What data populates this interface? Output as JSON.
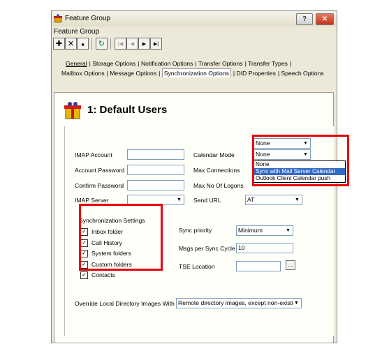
{
  "window": {
    "title": "Feature Group",
    "menu_label": "Feature Group",
    "help_btn": "?",
    "close_btn": "✕"
  },
  "toolbar": {
    "add": "✚",
    "delete": "✕",
    "save": "▪",
    "refresh": "↻",
    "first": "|◀",
    "prev": "◀",
    "next": "▶",
    "last": "▶|"
  },
  "tabs_row1": [
    "General",
    "Storage Options",
    "Notification Options",
    "Transfer Options",
    "Transfer Types"
  ],
  "tabs_row2": [
    "Mailbox Options",
    "Message Options",
    "Synchronization Options",
    "DID Properties",
    "Speech Options"
  ],
  "header": {
    "title": "1: Default Users",
    "icon": "gift-users-icon"
  },
  "form": {
    "imap_account": "IMAP Account",
    "account_password": "Account Password",
    "confirm_password": "Confirm Password",
    "imap_server": "IMAP Server",
    "calendar_mode": "Calendar Mode",
    "calendar_mode_value": "None",
    "max_connections": "Max Connections",
    "max_connections_value": "None",
    "max_logons": "Max No Of Logons",
    "send_url": "Send URL",
    "send_url_value": "AT",
    "dropdown_options": [
      "None",
      "Sync with Mail Server Calendar",
      "Outlook Client Calendar push"
    ]
  },
  "sync": {
    "group_label": "Synchronization Settings",
    "items": [
      "Inbox folder",
      "Call History",
      "System folders",
      "Custom folders",
      "Contacts"
    ],
    "sync_priority": "Sync priority",
    "sync_priority_value": "Minimum",
    "msgs_per_cycle": "Msgs per Sync Cycle",
    "msgs_per_cycle_value": "10",
    "tse_location": "TSE Location",
    "browse": "..."
  },
  "override": {
    "label": "Override Local Directory Images With",
    "value": "Remote directory images, except non-existi"
  },
  "colors": {
    "highlight": "#e8000b",
    "selection": "#316ac5"
  }
}
